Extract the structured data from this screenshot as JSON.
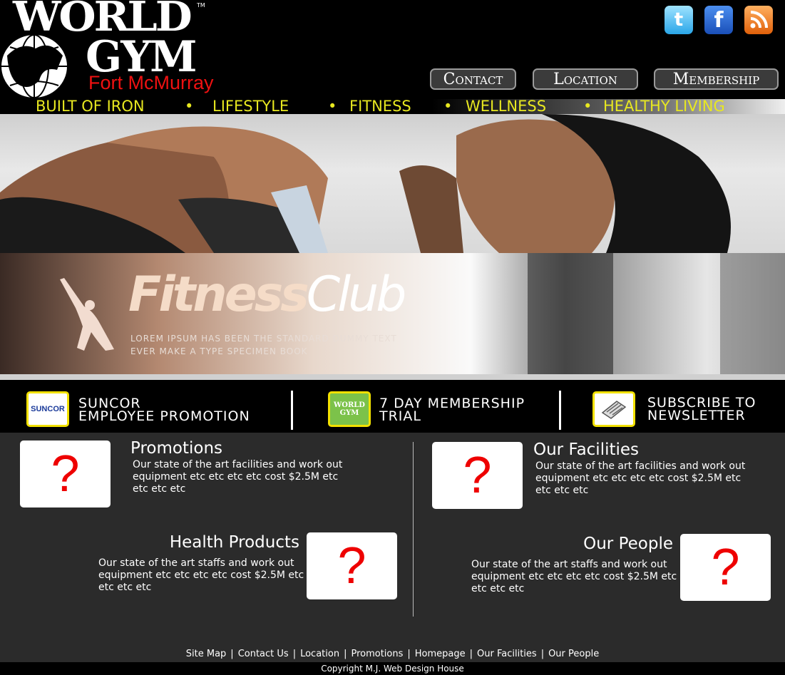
{
  "logo": {
    "line1": "WORLD",
    "line2": "GYM",
    "tm": "TM",
    "city": "Fort McMurray"
  },
  "social": {
    "twitter": "t",
    "facebook": "f"
  },
  "nav": {
    "contact": "Contact",
    "location": "Location",
    "membership": "Membership"
  },
  "tagline": [
    "BUILT OF IRON",
    "•",
    "LIFESTYLE",
    "•",
    "FITNESS",
    "•",
    "WELLNESS",
    "•",
    "HEALTHY LIVING"
  ],
  "banner": {
    "fitness": "Fitness",
    "club": "Club",
    "sub": "Lorem Ipsum has been the standard dummy text ever make a type specimen book"
  },
  "promo": {
    "suncor_logo": "SUNCOR",
    "suncor_line1": "SUNCOR",
    "suncor_line2": "EMPLOYEE PROMOTION",
    "trial_logo": "WORLD GYM",
    "trial_line1": "7 DAY MEMBERSHIP",
    "trial_line2": "TRIAL",
    "news_line1": "SUBSCRIBE TO",
    "news_line2": "NEWSLETTER"
  },
  "cards": {
    "promotions": {
      "title": "Promotions",
      "body": "Our state of the art facilities and work out equipment etc etc etc etc cost $2.5M etc etc etc etc",
      "img": "?"
    },
    "facilities": {
      "title": "Our Facilities",
      "body": "Our state of the art facilities and work out equipment etc etc etc etc cost $2.5M etc etc etc etc",
      "img": "?"
    },
    "health": {
      "title": "Health Products",
      "body": "Our state of the art staffs and work out equipment etc etc etc etc cost $2.5M etc etc etc etc",
      "img": "?"
    },
    "people": {
      "title": "Our People",
      "body": "Our state of the art staffs and work out equipment etc etc etc etc cost $2.5M etc etc etc etc",
      "img": "?"
    }
  },
  "footer": {
    "links": [
      "Site Map",
      "Contact Us",
      "Location",
      "Promotions",
      "Homepage",
      "Our Facilities",
      "Our People"
    ],
    "sep": "|",
    "copyright": "Copyright M.J. Web Design House"
  },
  "colors": {
    "accent": "#e8e820",
    "logo_red": "#e11111",
    "panel": "#2b2b2b",
    "promo_border": "#f2e100",
    "placeholder_red": "#ee0000"
  }
}
